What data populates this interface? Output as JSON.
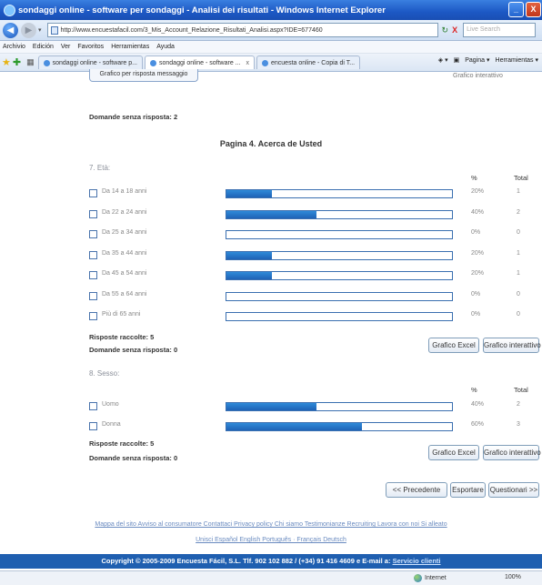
{
  "window": {
    "title": "sondaggi online - software per sondaggi - Analisi dei risultati - Windows Internet Explorer",
    "minimize_icon": "_",
    "close_icon": "X"
  },
  "address": {
    "back_icon": "◀",
    "forward_icon": "▶",
    "dropdown_icon": "▾",
    "url": "http://www.encuestafacil.com/3_Mis_Account_Relazione_Risultati_Analisi.aspx?IDE=677460",
    "refresh_icon": "↻",
    "stop_icon": "X",
    "search_placeholder": "Live Search"
  },
  "menu": [
    "Archivio",
    "Edición",
    "Ver",
    "Favoritos",
    "Herramientas",
    "Ayuda"
  ],
  "tabs": {
    "fav_star": "★",
    "fav_add": "✚",
    "grid_icon": "▦",
    "items": [
      {
        "label": "sondaggi online - software p...",
        "close": ""
      },
      {
        "label": "sondaggi online - software ...",
        "close": "x"
      },
      {
        "label": "encuesta online - Copia di T...",
        "close": ""
      }
    ],
    "commands": {
      "feed": "◈ ▾",
      "print": "▣",
      "page": "Pagina ▾",
      "tools": "Herramientas ▾"
    }
  },
  "content": {
    "cut_button": "Grafico per risposta messaggio",
    "cut_right": "Grafico interattivo",
    "unanswered_top": "Domande senza risposta: 2",
    "page_title": "Pagina 4. Acerca de Usted",
    "col_pct": "%",
    "col_total": "Total",
    "q7": {
      "title": "7. Età:",
      "options": [
        {
          "label": "Da 14 a 18 anni",
          "pct": "20%",
          "pct_value": 20,
          "total": "1"
        },
        {
          "label": "Da 22 a 24 anni",
          "pct": "40%",
          "pct_value": 40,
          "total": "2"
        },
        {
          "label": "Da 25 a 34 anni",
          "pct": "0%",
          "pct_value": 0,
          "total": "0"
        },
        {
          "label": "Da 35 a 44 anni",
          "pct": "20%",
          "pct_value": 20,
          "total": "1"
        },
        {
          "label": "Da 45 a 54 anni",
          "pct": "20%",
          "pct_value": 20,
          "total": "1"
        },
        {
          "label": "Da 55 a 64 anni",
          "pct": "0%",
          "pct_value": 0,
          "total": "0"
        },
        {
          "label": "Più di 65 anni",
          "pct": "0%",
          "pct_value": 0,
          "total": "0"
        }
      ],
      "collected": "Risposte raccolte: 5",
      "unanswered": "Domande senza risposta: 0",
      "btn_excel": "Grafico Excel",
      "btn_interactive": "Grafico interattivo"
    },
    "q8": {
      "title": "8. Sesso:",
      "options": [
        {
          "label": "Uomo",
          "pct": "40%",
          "pct_value": 40,
          "total": "2"
        },
        {
          "label": "Donna",
          "pct": "60%",
          "pct_value": 60,
          "total": "3"
        }
      ],
      "collected": "Risposte raccolte: 5",
      "unanswered": "Domande senza risposta: 0",
      "btn_excel": "Grafico Excel",
      "btn_interactive": "Grafico interattivo"
    },
    "nav": {
      "prev": "<< Precedente",
      "export": "Esportare",
      "next": "Questionari >>"
    },
    "footer_links_1": "Mappa del sito  Avviso al consumatore  Contattaci  Privacy policy  Chi siamo  Testimonianze  Recruiting  Lavora con noi  Si alleato",
    "footer_links_2": "Unisci  Español  English  Português  ·  Français  Deutsch",
    "copyright": "Copyright © 2005-2009 Encuesta Fácil, S.L. Tlf. 902 102 882 / (+34) 91 416 4609 e E-mail a:",
    "copyright_link": "Servicio clienti"
  },
  "status": {
    "zone": "Internet",
    "zoom": "100%"
  }
}
